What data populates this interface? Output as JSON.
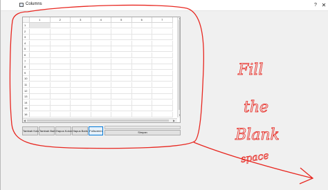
{
  "window": {
    "title": "Columns",
    "help_label": "?",
    "close_label": "✕"
  },
  "table": {
    "columns": [
      "1",
      "2",
      "3",
      "4",
      "5",
      "6",
      "7"
    ],
    "rows": [
      "1",
      "2",
      "3",
      "4",
      "5",
      "6",
      "7",
      "8",
      "9",
      "10",
      "11",
      "12",
      "13",
      "14",
      "15",
      "16"
    ],
    "selected_cell": {
      "row": 1,
      "col": 1
    }
  },
  "buttons": {
    "add_column": "Tambah Kolom",
    "add_row": "Tambah Baris",
    "delete_column": "Hapus Kolom",
    "delete_row": "Hapus Baris",
    "fullscreen": "Fullscreen",
    "save": "Simpan"
  },
  "annotation": {
    "line1": "Fill",
    "line2": "the",
    "line3": "Blank",
    "line4": "space",
    "color": "#e8261f"
  }
}
